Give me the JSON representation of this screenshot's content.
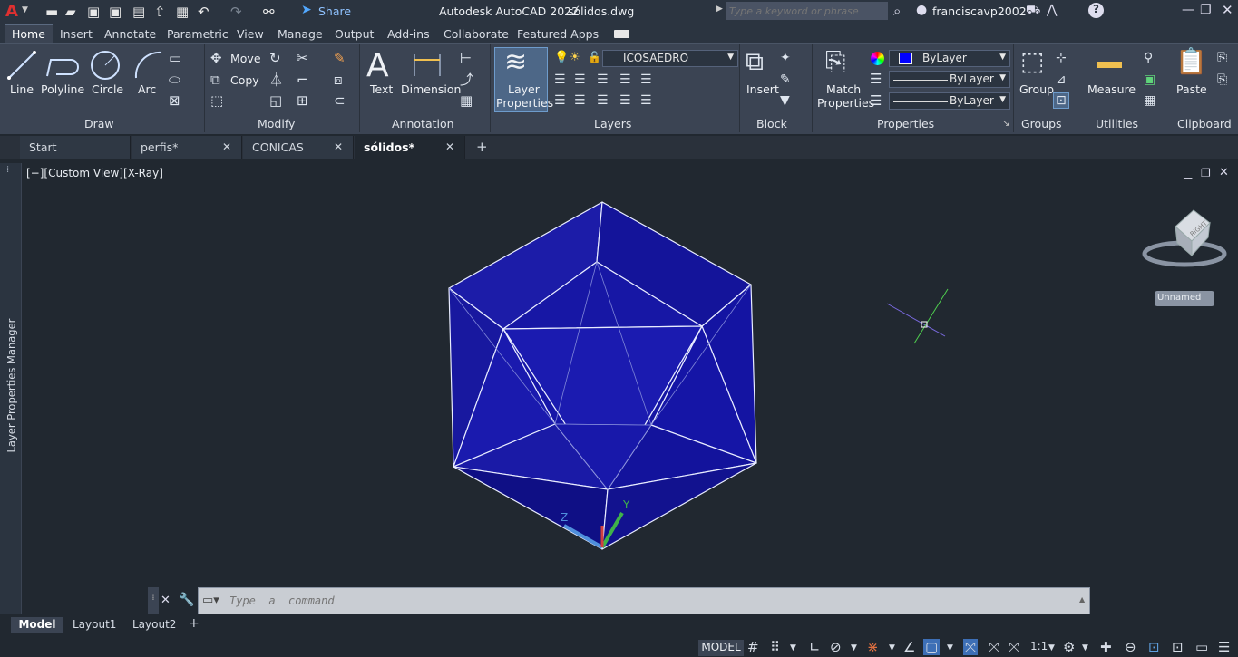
{
  "app": {
    "title": "Autodesk AutoCAD 2022",
    "file": "sólidos.dwg",
    "share_label": "Share",
    "search_placeholder": "Type a keyword or phrase",
    "user": "franciscavp2002",
    "logo": "A"
  },
  "ribbon_tabs": [
    "Home",
    "Insert",
    "Annotate",
    "Parametric",
    "View",
    "Manage",
    "Output",
    "Add-ins",
    "Collaborate",
    "Featured Apps"
  ],
  "draw": {
    "line": "Line",
    "polyline": "Polyline",
    "circle": "Circle",
    "arc": "Arc",
    "panel": "Draw"
  },
  "modify": {
    "move": "Move",
    "copy": "Copy",
    "panel": "Modify"
  },
  "annotation": {
    "text": "Text",
    "dimension": "Dimension",
    "panel": "Annotation"
  },
  "layers": {
    "layer_properties_1": "Layer",
    "layer_properties_2": "Properties",
    "current_layer": "ICOSAEDRO",
    "panel": "Layers"
  },
  "block": {
    "insert": "Insert",
    "panel": "Block"
  },
  "properties": {
    "match_1": "Match",
    "match_2": "Properties",
    "color": "ByLayer",
    "linetype": "ByLayer",
    "lineweight": "ByLayer",
    "panel": "Properties"
  },
  "groups": {
    "group": "Group",
    "panel": "Groups"
  },
  "utilities": {
    "measure": "Measure",
    "panel": "Utilities"
  },
  "clipboard": {
    "paste": "Paste",
    "panel": "Clipboard"
  },
  "doc_tabs": [
    "Start",
    "perfis*",
    "CONICAS",
    "sólidos*"
  ],
  "viewport": {
    "label": "[−][Custom View][X-Ray]",
    "viewcube_face": "RIGHT",
    "unnamed": "Unnamed",
    "ucs_z": "Z",
    "ucs_y": "Y"
  },
  "side_panel": "Layer Properties Manager",
  "command": {
    "placeholder": "Type  a  command"
  },
  "layout_tabs": [
    "Model",
    "Layout1",
    "Layout2"
  ],
  "status": {
    "model": "MODEL",
    "scale": "1:1"
  },
  "colors": {
    "accent": "#1976d2",
    "solid": "#1a1aa8",
    "viewport": "#212830"
  }
}
